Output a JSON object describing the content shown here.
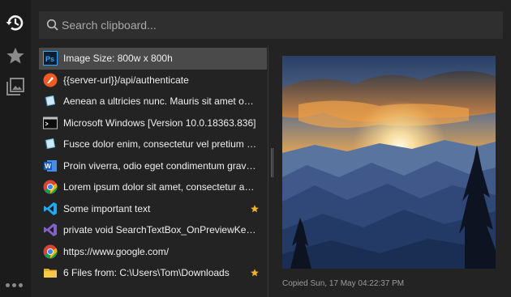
{
  "search": {
    "placeholder": "Search clipboard..."
  },
  "rail": {
    "items": [
      {
        "name": "history-icon"
      },
      {
        "name": "star-icon"
      },
      {
        "name": "images-icon"
      }
    ]
  },
  "clips": [
    {
      "text": "Image Size: 800w x 800h",
      "icon": "photoshop-icon",
      "selected": true,
      "starred": false
    },
    {
      "text": "{{server-url}}/api/authenticate",
      "icon": "postman-icon",
      "selected": false,
      "starred": false
    },
    {
      "text": "Aenean a ultricies nunc. Mauris sit amet odio n...",
      "icon": "notepad-icon",
      "selected": false,
      "starred": false
    },
    {
      "text": "Microsoft Windows [Version 10.0.18363.836]",
      "icon": "terminal-icon",
      "selected": false,
      "starred": false
    },
    {
      "text": "Fusce dolor enim, consectetur vel pretium in, o...",
      "icon": "notepad-icon",
      "selected": false,
      "starred": false
    },
    {
      "text": "Proin viverra, odio eget condimentum gravida,...",
      "icon": "word-icon",
      "selected": false,
      "starred": false
    },
    {
      "text": "Lorem ipsum dolor sit amet, consectetur adipi...",
      "icon": "chrome-icon",
      "selected": false,
      "starred": false
    },
    {
      "text": "Some important text",
      "icon": "vscode-icon",
      "selected": false,
      "starred": true
    },
    {
      "text": "private void SearchTextBox_OnPreviewKeyDow...",
      "icon": "visual-studio-icon",
      "selected": false,
      "starred": false
    },
    {
      "text": "https://www.google.com/",
      "icon": "chrome-icon",
      "selected": false,
      "starred": false
    },
    {
      "text": "6 Files from: C:\\Users\\Tom\\Downloads",
      "icon": "folder-icon",
      "selected": false,
      "starred": true
    }
  ],
  "preview": {
    "caption": "Copied Sun, 17 May 04:22:37 PM"
  },
  "colors": {
    "accent_star": "#f0b429",
    "selected_bg": "#4a4a4a"
  }
}
